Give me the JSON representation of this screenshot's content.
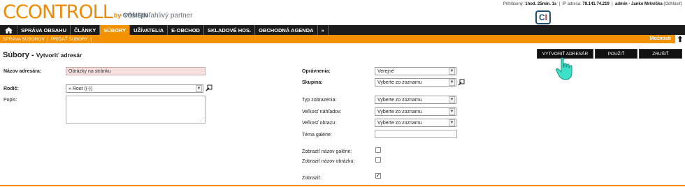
{
  "brand": {
    "logo_text": "CCONTROLL",
    "by": "by",
    "company": "COMEIN",
    "tagline": "- váš spoľahlivý partner",
    "ci_badge": {
      "c": "C",
      "i": "I"
    }
  },
  "session": {
    "logged_label": "Prihlásený:",
    "logged_value": "1hod. 25min. 1s",
    "ip_label": "IP adresa:",
    "ip_value": "78.141.74.219",
    "user": "admin - Janko Mrkvička",
    "logout": "(Odhlásiť)"
  },
  "nav": {
    "home_icon": "home-icon",
    "items": [
      "SPRÁVA OBSAHU",
      "ČLÁNKY",
      "SÚBORY",
      "UŽÍVATELIA",
      "E-OBCHOD",
      "SKLADOVÉ HOS.",
      "OBCHODNÁ AGENDA",
      "»"
    ],
    "active_index": 2
  },
  "subnav": {
    "items": [
      "SPRÁVA SÚBOROV",
      "PRIDAŤ SÚBORY"
    ],
    "options": "Možnosti"
  },
  "page": {
    "title_main": "Súbory",
    "title_sep": " - ",
    "title_sub": "Vytvoriť adresár"
  },
  "actions": {
    "create": "VYTVORIŤ ADRESÁR",
    "apply": "POUŽIŤ",
    "cancel": "ZRUŠIŤ"
  },
  "form": {
    "name_label": "Názov adresára:",
    "name_value": "Obrázky na stránku",
    "parent_label": "Rodič:",
    "parent_value": "» Root ((-))",
    "desc_label": "Popis:",
    "desc_value": "",
    "perm_label": "Oprávnenia:",
    "perm_value": "Verejné",
    "group_label": "Skupina:",
    "group_value": "Vyberte zo zoznamu",
    "display_type_label": "Typ zobrazenia:",
    "display_type_value": "Vyberte zo zoznamu",
    "thumb_size_label": "Veľkosť náhľadov:",
    "thumb_size_value": "Vyberte zo zoznamu",
    "image_size_label": "Veľkosť obrazu:",
    "image_size_value": "Vyberte zo zoznamu",
    "gallery_theme_label": "Téma galérie:",
    "gallery_theme_value": "",
    "show_gallery_name_label": "Zobraziť názov galérie:",
    "show_gallery_name": false,
    "show_image_name_label": "Zobraziť názov obrázku:",
    "show_image_name": false,
    "show_label": "Zobraziť:",
    "show": true
  },
  "colors": {
    "accent": "#f39200",
    "nav_bg": "#1b1b1b",
    "pink_field": "#f6e0e0"
  }
}
